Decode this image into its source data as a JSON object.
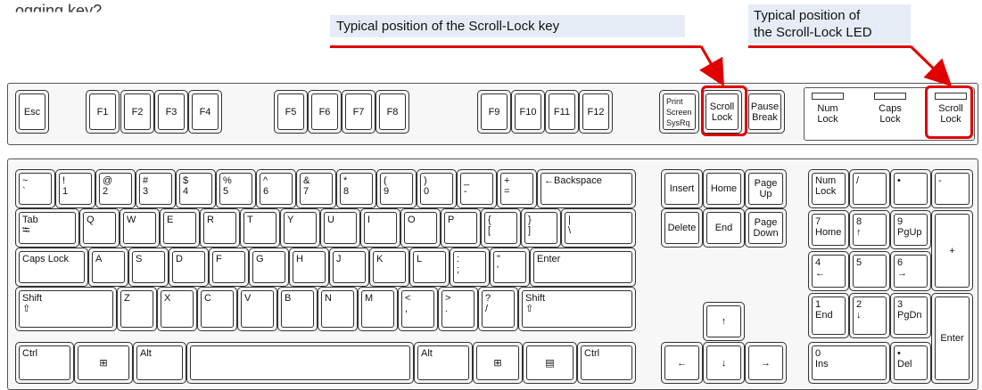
{
  "header_text": "...ogging key?",
  "callouts": {
    "scroll_key": "Typical position of the Scroll-Lock key",
    "scroll_led_line1": "Typical position of",
    "scroll_led_line2": "the Scroll-Lock LED"
  },
  "colors": {
    "highlight": "#e00000",
    "callout_bg": "#e6ecf5"
  },
  "rows": {
    "function": [
      {
        "id": "esc",
        "t": "Esc"
      },
      {
        "id": "f1",
        "t": "F1"
      },
      {
        "id": "f2",
        "t": "F2"
      },
      {
        "id": "f3",
        "t": "F3"
      },
      {
        "id": "f4",
        "t": "F4"
      },
      {
        "id": "f5",
        "t": "F5"
      },
      {
        "id": "f6",
        "t": "F6"
      },
      {
        "id": "f7",
        "t": "F7"
      },
      {
        "id": "f8",
        "t": "F8"
      },
      {
        "id": "f9",
        "t": "F9"
      },
      {
        "id": "f10",
        "t": "F10"
      },
      {
        "id": "f11",
        "t": "F11"
      },
      {
        "id": "f12",
        "t": "F12"
      },
      {
        "id": "printscreen",
        "t": "Print",
        "m": "Screen",
        "b": "SysRq"
      },
      {
        "id": "scrolllock",
        "t": "Scroll",
        "b": "Lock"
      },
      {
        "id": "pause",
        "t": "Pause",
        "b": "Break"
      }
    ],
    "number": [
      {
        "id": "tilde",
        "t": "~",
        "b": "`"
      },
      {
        "id": "1",
        "t": "!",
        "b": "1"
      },
      {
        "id": "2",
        "t": "@",
        "b": "2"
      },
      {
        "id": "3",
        "t": "#",
        "b": "3"
      },
      {
        "id": "4",
        "t": "$",
        "b": "4"
      },
      {
        "id": "5",
        "t": "%",
        "b": "5"
      },
      {
        "id": "6",
        "t": "^",
        "b": "6"
      },
      {
        "id": "7",
        "t": "&",
        "b": "7"
      },
      {
        "id": "8",
        "t": "*",
        "b": "8"
      },
      {
        "id": "9",
        "t": "(",
        "b": "9"
      },
      {
        "id": "0",
        "t": ")",
        "b": "0"
      },
      {
        "id": "minus",
        "t": "_",
        "b": "-"
      },
      {
        "id": "equals",
        "t": "+",
        "b": "="
      },
      {
        "id": "backspace",
        "t": "←Backspace"
      }
    ],
    "qwerty": [
      {
        "id": "tab",
        "t": "Tab",
        "b": "⭾"
      },
      {
        "id": "q",
        "t": "Q"
      },
      {
        "id": "w",
        "t": "W"
      },
      {
        "id": "e",
        "t": "E"
      },
      {
        "id": "r",
        "t": "R"
      },
      {
        "id": "t",
        "t": "T"
      },
      {
        "id": "y",
        "t": "Y"
      },
      {
        "id": "u",
        "t": "U"
      },
      {
        "id": "i",
        "t": "I"
      },
      {
        "id": "o",
        "t": "O"
      },
      {
        "id": "p",
        "t": "P"
      },
      {
        "id": "lbrace",
        "t": "{",
        "b": "["
      },
      {
        "id": "rbrace",
        "t": "}",
        "b": "]"
      },
      {
        "id": "pipe",
        "t": "|",
        "b": "\\"
      }
    ],
    "home": [
      {
        "id": "capslock",
        "t": "Caps Lock"
      },
      {
        "id": "a",
        "t": "A"
      },
      {
        "id": "s",
        "t": "S"
      },
      {
        "id": "d",
        "t": "D"
      },
      {
        "id": "f",
        "t": "F"
      },
      {
        "id": "g",
        "t": "G"
      },
      {
        "id": "h",
        "t": "H"
      },
      {
        "id": "j",
        "t": "J"
      },
      {
        "id": "k",
        "t": "K"
      },
      {
        "id": "l",
        "t": "L"
      },
      {
        "id": "semicolon",
        "t": ":",
        "b": ";"
      },
      {
        "id": "quote",
        "t": "\"",
        "b": "'"
      },
      {
        "id": "enter",
        "t": "Enter"
      }
    ],
    "shift": [
      {
        "id": "lshift",
        "t": "Shift",
        "b": "⇧"
      },
      {
        "id": "z",
        "t": "Z"
      },
      {
        "id": "x",
        "t": "X"
      },
      {
        "id": "c",
        "t": "C"
      },
      {
        "id": "v",
        "t": "V"
      },
      {
        "id": "b",
        "t": "B"
      },
      {
        "id": "n",
        "t": "N"
      },
      {
        "id": "m",
        "t": "M"
      },
      {
        "id": "comma",
        "t": "<",
        "b": ","
      },
      {
        "id": "period",
        "t": ">",
        "b": "."
      },
      {
        "id": "slash",
        "t": "?",
        "b": "/"
      },
      {
        "id": "rshift",
        "t": "Shift",
        "b": "⇧"
      }
    ],
    "bottom": [
      {
        "id": "lctrl",
        "t": "Ctrl"
      },
      {
        "id": "lwin",
        "t": "⊞"
      },
      {
        "id": "lalt",
        "t": "Alt"
      },
      {
        "id": "space",
        "t": ""
      },
      {
        "id": "ralt",
        "t": "Alt"
      },
      {
        "id": "rwin",
        "t": "⊞"
      },
      {
        "id": "menu",
        "t": "▤"
      },
      {
        "id": "rctrl",
        "t": "Ctrl"
      }
    ],
    "nav": [
      {
        "id": "insert",
        "t": "Insert"
      },
      {
        "id": "home",
        "t": "Home"
      },
      {
        "id": "pageup",
        "t": "Page",
        "b": "Up"
      },
      {
        "id": "delete",
        "t": "Delete"
      },
      {
        "id": "end",
        "t": "End"
      },
      {
        "id": "pagedown",
        "t": "Page",
        "b": "Down"
      },
      {
        "id": "up",
        "t": "↑"
      },
      {
        "id": "left",
        "t": "←"
      },
      {
        "id": "down",
        "t": "↓"
      },
      {
        "id": "right",
        "t": "→"
      }
    ],
    "numpad": [
      {
        "id": "numlock",
        "t": "Num",
        "b": "Lock"
      },
      {
        "id": "np_div",
        "t": "/"
      },
      {
        "id": "np_mul",
        "t": "•"
      },
      {
        "id": "np_sub",
        "t": "-"
      },
      {
        "id": "np7",
        "t": "7",
        "b": "Home"
      },
      {
        "id": "np8",
        "t": "8",
        "b": "↑"
      },
      {
        "id": "np9",
        "t": "9",
        "b": "PgUp"
      },
      {
        "id": "np_add",
        "t": "+"
      },
      {
        "id": "np4",
        "t": "4",
        "b": "←"
      },
      {
        "id": "np5",
        "t": "5"
      },
      {
        "id": "np6",
        "t": "6",
        "b": "→"
      },
      {
        "id": "np1",
        "t": "1",
        "b": "End"
      },
      {
        "id": "np2",
        "t": "2",
        "b": "↓"
      },
      {
        "id": "np3",
        "t": "3",
        "b": "PgDn"
      },
      {
        "id": "np_enter",
        "t": "Enter"
      },
      {
        "id": "np0",
        "t": "0",
        "b": "Ins"
      },
      {
        "id": "np_dot",
        "t": "•",
        "b": "Del"
      }
    ]
  },
  "leds": [
    {
      "id": "num",
      "t": "Num",
      "b": "Lock"
    },
    {
      "id": "caps",
      "t": "Caps",
      "b": "Lock"
    },
    {
      "id": "scroll",
      "t": "Scroll",
      "b": "Lock"
    }
  ]
}
